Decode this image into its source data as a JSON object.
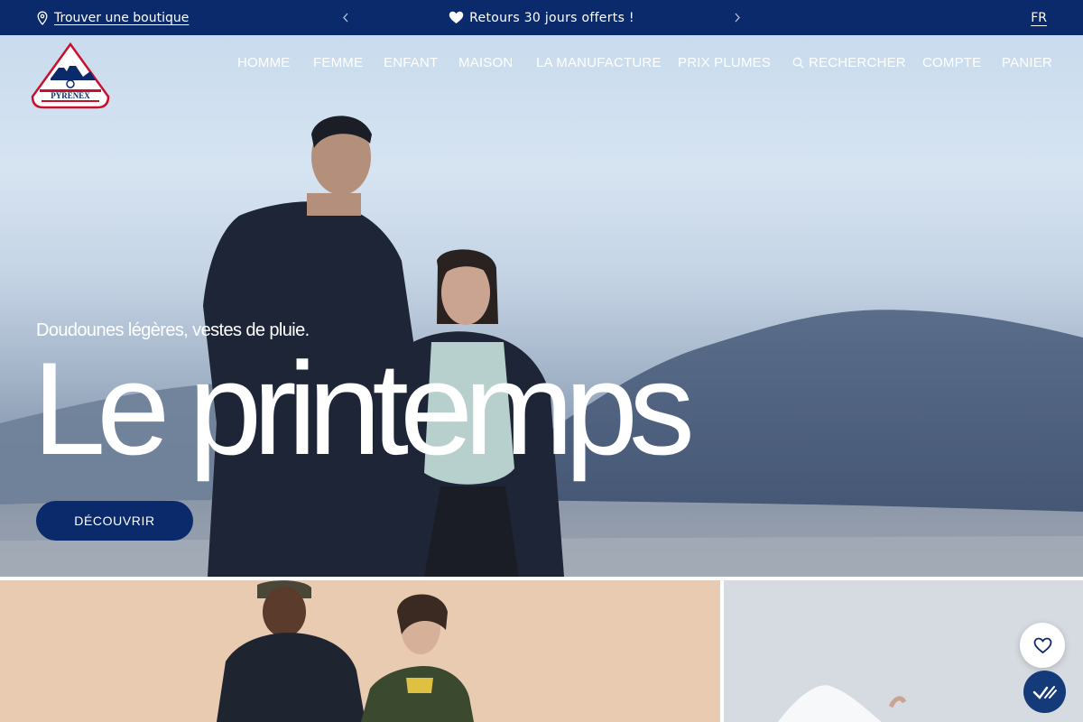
{
  "announcement": {
    "store_link": "Trouver une boutique",
    "message": "Retours 30 jours offerts !",
    "language": "FR"
  },
  "logo": {
    "text": "PYRENEX"
  },
  "nav": {
    "items": [
      "HOMME",
      "FEMME",
      "ENFANT",
      "MAISON",
      "LA MANUFACTURE",
      "PRIX PLUMES"
    ],
    "search": "RECHERCHER",
    "account": "COMPTE",
    "cart": "PANIER"
  },
  "hero": {
    "subtitle": "Doudounes légères, vestes de pluie.",
    "title": "Le printemps",
    "cta": "DÉCOUVRIR"
  },
  "colors": {
    "brand_navy": "#0b2a6b",
    "logo_red": "#c8102e",
    "white": "#ffffff"
  },
  "icons": {
    "store": "map-pin-icon",
    "prev": "chevron-left-icon",
    "next": "chevron-right-icon",
    "heart": "heart-icon",
    "search": "search-icon",
    "wishlist": "heart-outline-icon",
    "consent": "checkmark-slash-icon"
  }
}
